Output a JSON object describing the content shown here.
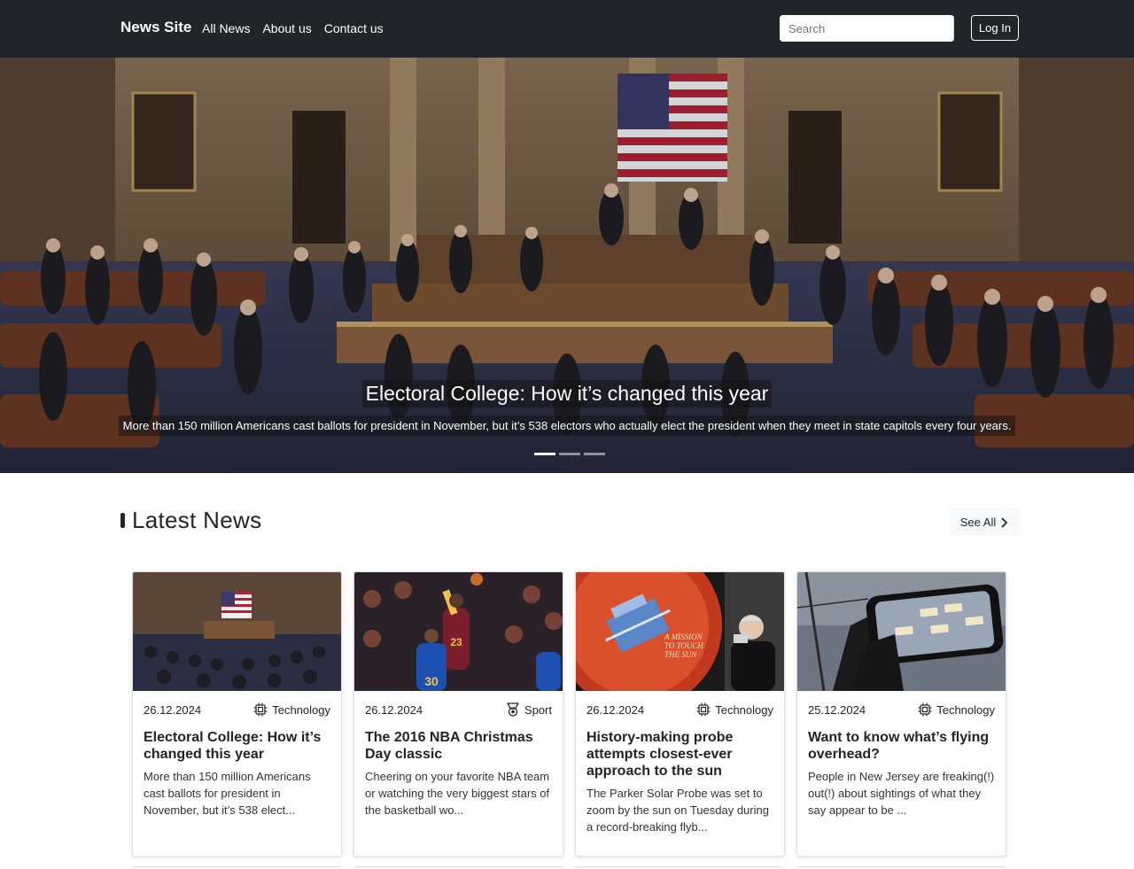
{
  "navbar": {
    "brand": "News Site",
    "links": [
      "All News",
      "About us",
      "Contact us"
    ],
    "search_placeholder": "Search",
    "login_label": "Log In"
  },
  "hero": {
    "title": "Electoral College: How it’s changed this year",
    "subtitle": "More than 150 million Americans cast ballots for president in November, but it’s 538 electors who actually elect the president when they meet in state capitols every four years.",
    "slide_count": 3,
    "active_slide": 1
  },
  "latest": {
    "title": "Latest News",
    "see_all_label": "See All",
    "cards": [
      {
        "date": "26.12.2024",
        "category": "Technology",
        "category_icon": "cpu-icon",
        "title": "Electoral College: How it’s changed this year",
        "text": "More than 150 million Americans cast ballots for president in November, but it’s 538 elect..."
      },
      {
        "date": "26.12.2024",
        "category": "Sport",
        "category_icon": "medal-icon",
        "title": "The 2016 NBA Christmas Day classic",
        "text": "Cheering on your favorite NBA team or watching the very biggest stars of the basketball wo..."
      },
      {
        "date": "26.12.2024",
        "category": "Technology",
        "category_icon": "cpu-icon",
        "title": "History-making probe attempts closest-ever approach to the sun",
        "text": "The Parker Solar Probe was set to zoom by the sun on Tuesday during a record-breaking flyb..."
      },
      {
        "date": "25.12.2024",
        "category": "Technology",
        "category_icon": "cpu-icon",
        "title": "Want to know what’s flying overhead?",
        "text": "People in New Jersey are freaking(!) out(!) about sightings of what they say appear to be ..."
      }
    ]
  },
  "colors": {
    "navbar_bg": "#212529",
    "text": "#212529",
    "see_all_bg": "#f8f9fa"
  }
}
